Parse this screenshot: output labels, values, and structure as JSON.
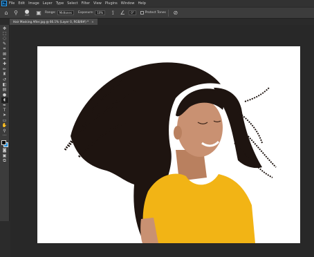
{
  "menubar": {
    "logo": "Ps",
    "items": [
      "File",
      "Edit",
      "Image",
      "Layer",
      "Type",
      "Select",
      "Filter",
      "View",
      "Plugins",
      "Window",
      "Help"
    ]
  },
  "options": {
    "brush_size": "450",
    "range_label": "Range:",
    "range_value": "Midtones",
    "exposure_label": "Exposure:",
    "exposure_value": "10%",
    "angle_value": "0°",
    "protect_tones_label": "Protect Tones"
  },
  "document": {
    "tab_title": "Hair Masking After.jpg @ 66.1% (Layer 0, RGB/8#) *",
    "close_glyph": "×"
  },
  "tools": [
    {
      "name": "move-tool",
      "glyph": "✥"
    },
    {
      "name": "marquee-tool",
      "glyph": "⬚"
    },
    {
      "name": "lasso-tool",
      "glyph": "◌"
    },
    {
      "name": "quick-selection-tool",
      "glyph": "✎"
    },
    {
      "name": "crop-tool",
      "glyph": "⌗"
    },
    {
      "name": "frame-tool",
      "glyph": "⊠"
    },
    {
      "name": "eyedropper-tool",
      "glyph": "✒"
    },
    {
      "name": "healing-brush-tool",
      "glyph": "✚"
    },
    {
      "name": "brush-tool",
      "glyph": "✏"
    },
    {
      "name": "clone-stamp-tool",
      "glyph": "♜"
    },
    {
      "name": "history-brush-tool",
      "glyph": "↺"
    },
    {
      "name": "eraser-tool",
      "glyph": "◧"
    },
    {
      "name": "gradient-tool",
      "glyph": "▤"
    },
    {
      "name": "blur-tool",
      "glyph": "●"
    },
    {
      "name": "dodge-tool",
      "glyph": "◖"
    },
    {
      "name": "pen-tool",
      "glyph": "✒"
    },
    {
      "name": "type-tool",
      "glyph": "T"
    },
    {
      "name": "path-selection-tool",
      "glyph": "➤"
    },
    {
      "name": "rectangle-tool",
      "glyph": "▭"
    },
    {
      "name": "hand-tool",
      "glyph": "✋"
    },
    {
      "name": "zoom-tool",
      "glyph": "⚲"
    },
    {
      "name": "more-tools",
      "glyph": "···"
    }
  ],
  "tools_after_swatches": [
    {
      "name": "quick-mask-button",
      "glyph": "◙"
    },
    {
      "name": "screen-mode-button",
      "glyph": "▣"
    },
    {
      "name": "extra-tools-button",
      "glyph": "⧉"
    }
  ],
  "colors": {
    "foreground": "#0a0a0a",
    "background": "#1d8fe0",
    "canvas": "#ffffff",
    "hair": "#1e1410",
    "skin": "#c99172",
    "shirt": "#f2b415"
  }
}
